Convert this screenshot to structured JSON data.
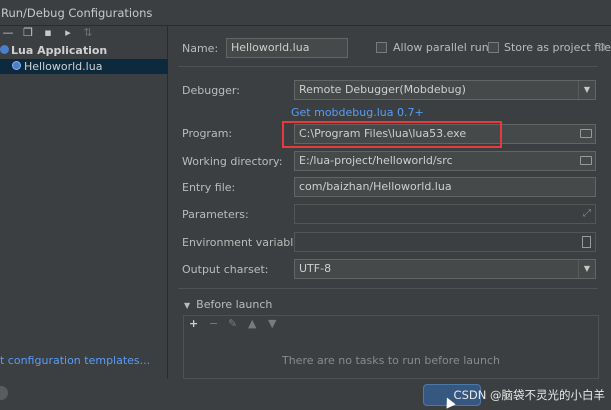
{
  "window": {
    "title": "Run/Debug Configurations"
  },
  "left_panel": {
    "toolbar_icons": [
      "minus-icon",
      "copy-icon",
      "save-icon",
      "folder-move-icon",
      "sort-icon"
    ],
    "tree": {
      "group_label": "Lua Application",
      "items": [
        {
          "label": "Helloworld.lua",
          "selected": true
        }
      ]
    },
    "templates_link": "t configuration templates..."
  },
  "form": {
    "name_label": "Name:",
    "name_value": "Helloworld.lua",
    "allow_parallel_label": "Allow parallel run",
    "store_as_project_label": "Store as project file",
    "debugger_label": "Debugger:",
    "debugger_value": "Remote Debugger(Mobdebug)",
    "get_mobdebug_link": "Get mobdebug.lua 0.7+",
    "program_label": "Program:",
    "program_value": "C:\\Program Files\\lua\\lua53.exe",
    "working_dir_label": "Working directory:",
    "working_dir_value": "E:/lua-project/helloworld/src",
    "entry_file_label": "Entry file:",
    "entry_file_value": "com/baizhan/Helloworld.lua",
    "parameters_label": "Parameters:",
    "parameters_value": "",
    "env_vars_label": "Environment variables:",
    "env_vars_value": "",
    "output_charset_label": "Output charset:",
    "output_charset_value": "UTF-8"
  },
  "before_launch": {
    "title": "Before launch",
    "toolbar": [
      "+",
      "−",
      "✎",
      "▲",
      "▼"
    ],
    "empty_text": "There are no tasks to run before launch"
  },
  "footer": {
    "watermark": "CSDN @脑袋不灵光的小白羊"
  },
  "colors": {
    "background": "#3c3f41",
    "link": "#589df6",
    "highlight": "#e53b3b",
    "selection": "#0d293e"
  }
}
